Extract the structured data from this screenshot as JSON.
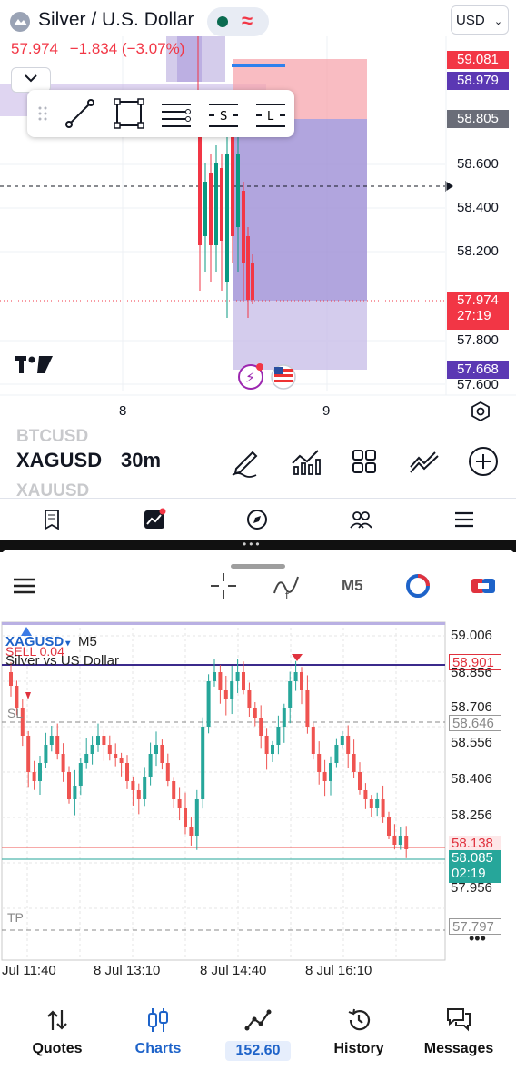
{
  "top_chart": {
    "instrument_title": "Silver / U.S. Dollar",
    "last_price": "57.974",
    "change": "−1.834 (−3.07%)",
    "currency": "USD",
    "price_tags": {
      "upper_red": "59.081",
      "upper_purple": "58.979",
      "gray": "58.805",
      "current": "57.974",
      "countdown": "27:19",
      "lower_purple": "57.668"
    },
    "price_axis": [
      "58.600",
      "58.400",
      "58.200",
      "57.800",
      "57.600"
    ],
    "date_axis": [
      "8",
      "9"
    ],
    "symbol_wheel": {
      "prev": "BTCUSD",
      "current": "XAGUSD",
      "next": "XAUUSD"
    },
    "timeframe": "30m",
    "colors": {
      "up": "#089981",
      "down": "#f23645",
      "loss_zone": "#f7a5ad",
      "profit_zone": "#9e8fd6"
    },
    "icons": [
      "pencil-icon",
      "indicators-icon",
      "grid-icon",
      "compare-icon",
      "add-icon",
      "watchlist-icon",
      "ideas-icon",
      "explore-icon",
      "community-icon",
      "menu-icon"
    ]
  },
  "mt_chart": {
    "timeframe_button": "M5",
    "symbol": "XAGUSD",
    "symbol_arrow": "▾",
    "chart_timeframe": "M5",
    "description": "Silver vs US Dollar",
    "order_label": "SELL 0.04",
    "sl_label": "SL",
    "tp_label": "TP",
    "price_axis": [
      "59.006",
      "58.856",
      "58.706",
      "58.556",
      "58.406",
      "58.256",
      "57.956"
    ],
    "price_tags": {
      "order": "58.901",
      "sl": "58.646",
      "bid": "58.138",
      "ask": "58.085",
      "countdown": "02:19",
      "tp": "57.797"
    },
    "time_axis": [
      "Jul 11:40",
      "8 Jul 13:10",
      "8 Jul 14:40",
      "8 Jul 16:10"
    ],
    "colors": {
      "up": "#26a69a",
      "down": "#ef5350",
      "order_line": "#3b2a8c",
      "sl_tp_line": "#888888"
    }
  },
  "bottom_nav": {
    "items": [
      {
        "label": "Quotes",
        "icon": "arrows-updown-icon"
      },
      {
        "label": "Charts",
        "icon": "candles-icon"
      },
      {
        "label": "152.60",
        "icon": "trade-icon"
      },
      {
        "label": "History",
        "icon": "history-icon"
      },
      {
        "label": "Messages",
        "icon": "messages-icon"
      }
    ],
    "active": "Charts"
  }
}
